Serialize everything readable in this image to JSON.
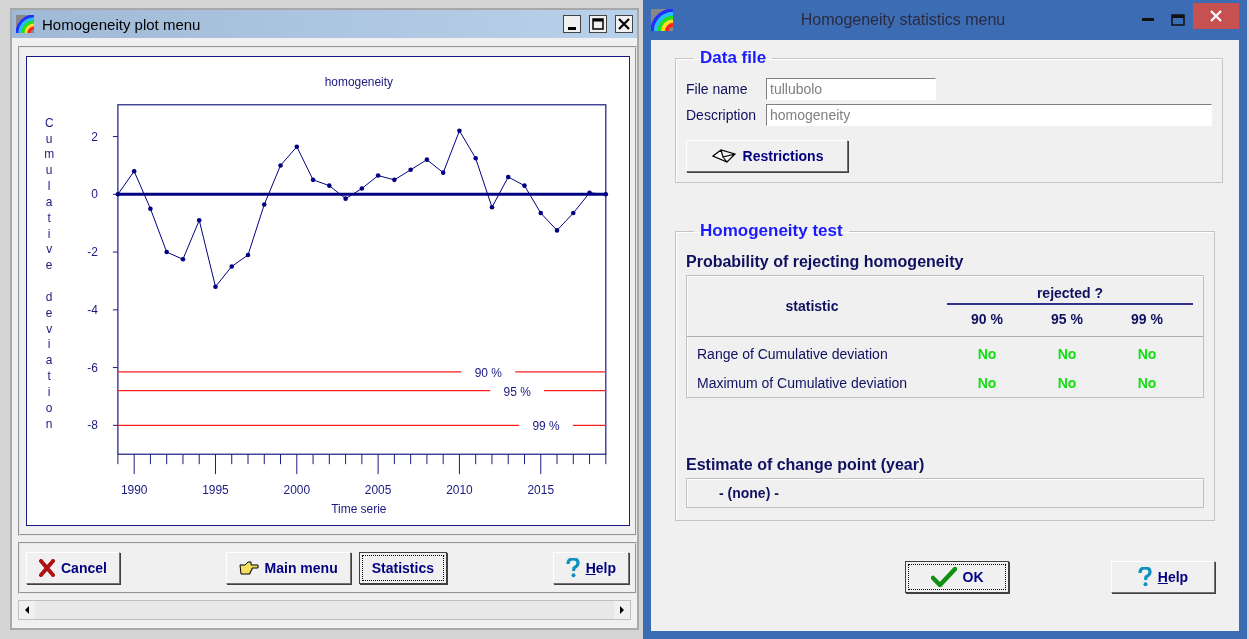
{
  "plot_window": {
    "title": "Homogeneity plot menu",
    "chart_data": {
      "type": "line",
      "title": "homogeneity",
      "xlabel": "Time serie",
      "ylabel": "Cumulative deviation",
      "x": [
        1989,
        1990,
        1991,
        1992,
        1993,
        1994,
        1995,
        1996,
        1997,
        1998,
        1999,
        2000,
        2001,
        2002,
        2003,
        2004,
        2005,
        2006,
        2007,
        2008,
        2009,
        2010,
        2011,
        2012,
        2013,
        2014,
        2015,
        2016,
        2017,
        2018,
        2019
      ],
      "series": [
        {
          "color": "#000080",
          "values": [
            0,
            0.8,
            -0.5,
            -2.0,
            -2.25,
            -0.9,
            -3.2,
            -2.5,
            -2.1,
            -0.35,
            1.0,
            1.65,
            0.5,
            0.3,
            -0.15,
            0.2,
            0.65,
            0.5,
            0.85,
            1.2,
            0.75,
            2.2,
            1.25,
            -0.45,
            0.6,
            0.3,
            -0.65,
            -1.25,
            -0.65,
            0.05,
            0
          ]
        }
      ],
      "xlim": [
        1989,
        2019
      ],
      "ylim": [
        -9,
        3.1
      ],
      "xticks": [
        1990,
        1995,
        2000,
        2005,
        2010,
        2015
      ],
      "yticks": [
        -8,
        -6,
        -4,
        -2,
        0,
        2
      ],
      "ref_lines": [
        {
          "axis": "y",
          "value": 0,
          "color": "#000080"
        },
        {
          "axis": "y",
          "value": -6.15,
          "color": "#ff2020"
        },
        {
          "axis": "y",
          "value": -6.8,
          "color": "#ff2020"
        },
        {
          "axis": "y",
          "value": -8,
          "color": "#ff2020"
        }
      ],
      "annotations": [
        "90 %",
        "95 %",
        "99 %"
      ]
    },
    "buttons": [
      {
        "label": "Cancel",
        "kind": "cross",
        "focused": false,
        "underline_first": false
      },
      {
        "label": "Main menu",
        "kind": "hand",
        "focused": false,
        "underline_first": false
      },
      {
        "label": "Statistics",
        "kind": "plain",
        "focused": true,
        "underline_first": false
      },
      {
        "label": "Help",
        "kind": "question",
        "focused": false,
        "underline_first": true
      }
    ]
  },
  "stats_window": {
    "title": "Homogeneity statistics menu",
    "data_file": {
      "legend": "Data file",
      "fields": [
        {
          "label": "File name",
          "value": "tullubolo",
          "disabled": true
        },
        {
          "label": "Description",
          "value": "homogeneity",
          "disabled": true
        }
      ],
      "restrictions_button": "Restrictions"
    },
    "homogeneity_test": {
      "legend": "Homogeneity test",
      "heading": "Probability of rejecting homogeneity",
      "table": {
        "column_header": "statistic",
        "group_header": "rejected ?",
        "levels": [
          "90 %",
          "95 %",
          "99 %"
        ],
        "rows": [
          {
            "statistic": "Range of Cumulative deviation",
            "results": [
              "No",
              "No",
              "No"
            ]
          },
          {
            "statistic": "Maximum of Cumulative deviation",
            "results": [
              "No",
              "No",
              "No"
            ]
          }
        ]
      },
      "change_point_heading": "Estimate of change point (year)",
      "change_point_value": "- (none) -"
    },
    "buttons": [
      {
        "label": "OK",
        "kind": "check",
        "focused": true,
        "underline_first": false
      },
      {
        "label": "Help",
        "kind": "question",
        "focused": false,
        "underline_first": true
      }
    ]
  }
}
